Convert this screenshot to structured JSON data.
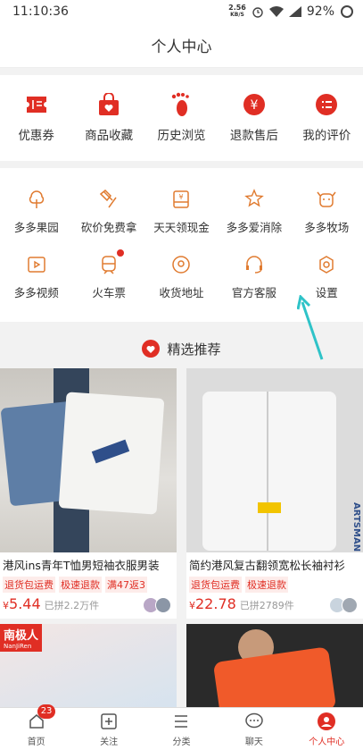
{
  "status": {
    "time": "11:10:36",
    "net_speed": "2.56",
    "net_unit": "KB/S",
    "battery": "92%"
  },
  "header": {
    "title": "个人中心"
  },
  "quick": [
    {
      "label": "优惠券",
      "icon": "coupon-icon"
    },
    {
      "label": "商品收藏",
      "icon": "bag-heart-icon"
    },
    {
      "label": "历史浏览",
      "icon": "footprint-icon"
    },
    {
      "label": "退款售后",
      "icon": "yen-circle-icon"
    },
    {
      "label": "我的评价",
      "icon": "comment-list-icon"
    }
  ],
  "services": [
    {
      "label": "多多果园",
      "icon": "tree-icon"
    },
    {
      "label": "砍价免费拿",
      "icon": "axe-icon"
    },
    {
      "label": "天天领现金",
      "icon": "cash-box-icon"
    },
    {
      "label": "多多爱消除",
      "icon": "star-wand-icon"
    },
    {
      "label": "多多牧场",
      "icon": "cow-icon"
    },
    {
      "label": "多多视频",
      "icon": "video-icon"
    },
    {
      "label": "火车票",
      "icon": "train-icon"
    },
    {
      "label": "收货地址",
      "icon": "location-icon"
    },
    {
      "label": "官方客服",
      "icon": "headset-icon"
    },
    {
      "label": "设置",
      "icon": "settings-gear-icon"
    }
  ],
  "recommend": {
    "title": "精选推荐"
  },
  "products": [
    {
      "title": "港风ins青年T恤男短袖衣服男装",
      "tags": [
        "退货包运费",
        "极速退款",
        "满47返3"
      ],
      "currency": "¥",
      "price_int": "5",
      "price_dec": ".44",
      "sold": "已拼2.2万件"
    },
    {
      "title": "简约港风复古翻领宽松长袖衬衫",
      "tags": [
        "退货包运费",
        "极速退款"
      ],
      "currency": "¥",
      "price_int": "22",
      "price_dec": ".78",
      "sold": "已拼2789件",
      "image_text": "ARTSMAN"
    }
  ],
  "row2": {
    "brand_cn": "南极人",
    "brand_en": "NanJiRen"
  },
  "tabs": [
    {
      "label": "首页",
      "badge": "23",
      "icon": "home-icon"
    },
    {
      "label": "关注",
      "icon": "plus-box-icon"
    },
    {
      "label": "分类",
      "icon": "menu-lines-icon"
    },
    {
      "label": "聊天",
      "icon": "chat-bubble-icon"
    },
    {
      "label": "个人中心",
      "icon": "profile-icon",
      "active": true
    }
  ],
  "colors": {
    "accent": "#e02e24",
    "service_icon": "#e07b30"
  }
}
